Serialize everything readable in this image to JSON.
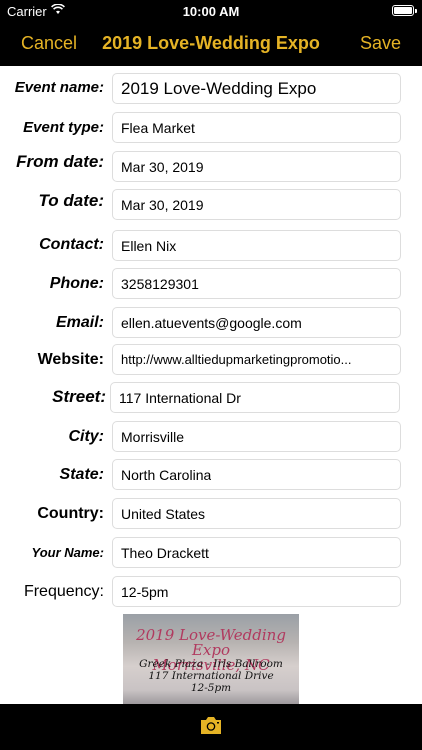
{
  "status": {
    "carrier": "Carrier",
    "time": "10:00 AM"
  },
  "nav": {
    "cancel": "Cancel",
    "title": "2019 Love-Wedding Expo",
    "save": "Save"
  },
  "form": {
    "event_name": {
      "label": "Event name:",
      "value": "2019 Love-Wedding Expo"
    },
    "event_type": {
      "label": "Event type:",
      "value": "Flea Market"
    },
    "from_date": {
      "label": "From date:",
      "value": "Mar 30, 2019"
    },
    "to_date": {
      "label": "To date:",
      "value": "Mar 30, 2019"
    },
    "contact": {
      "label": "Contact:",
      "value": "Ellen Nix"
    },
    "phone": {
      "label": "Phone:",
      "value": "3258129301"
    },
    "email": {
      "label": "Email:",
      "value": "ellen.atuevents@google.com"
    },
    "website": {
      "label": "Website:",
      "value": "http://www.alltiedupmarketingpromotio..."
    },
    "street": {
      "label": "Street:",
      "value": "117 International Dr"
    },
    "city": {
      "label": "City:",
      "value": "Morrisville"
    },
    "state": {
      "label": "State:",
      "value": "North Carolina"
    },
    "country": {
      "label": "Country:",
      "value": "United States"
    },
    "your_name": {
      "label": "Your Name:",
      "value": "Theo Drackett"
    },
    "frequency": {
      "label": "Frequency:",
      "value": "12-5pm"
    }
  },
  "flyer": {
    "line1": "2019 Love-Wedding Expo",
    "line2": "Morrisville, NC",
    "line3": "Greek Plaza - Iris Ballroom",
    "line4": "117 International Drive",
    "line5": "12-5pm"
  },
  "colors": {
    "accent": "#e5b325",
    "bar": "#000000"
  },
  "icons": {
    "camera": "camera-icon",
    "wifi": "wifi-icon",
    "battery": "battery-icon"
  }
}
